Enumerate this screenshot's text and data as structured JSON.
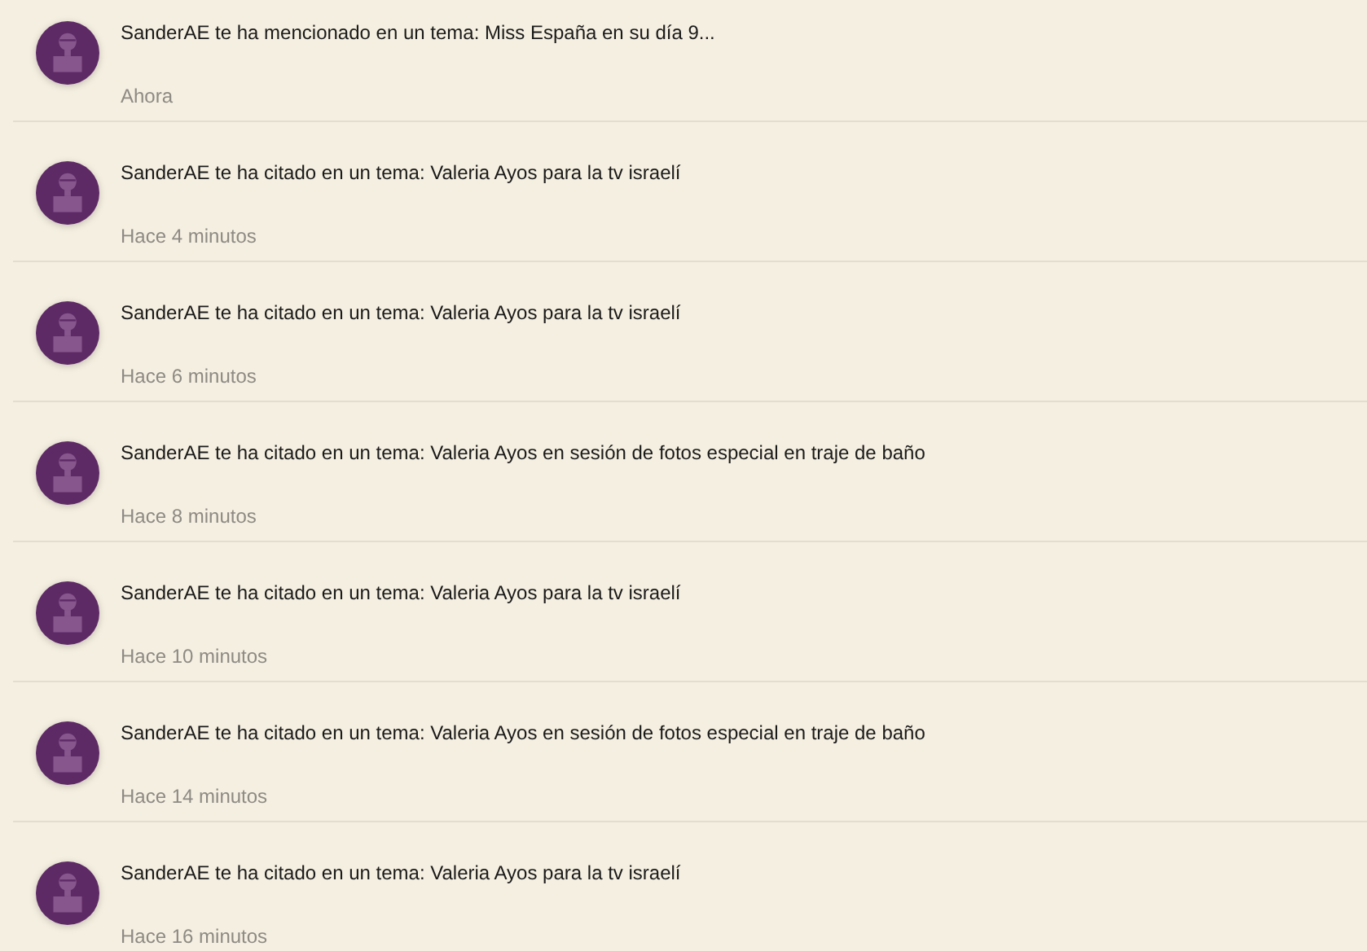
{
  "notifications": [
    {
      "message": "SanderAE te ha mencionado en un tema: Miss España en su día 9...",
      "time": "Ahora"
    },
    {
      "message": "SanderAE te ha citado en un tema: Valeria Ayos para la tv israelí",
      "time": "Hace 4 minutos"
    },
    {
      "message": "SanderAE te ha citado en un tema: Valeria Ayos para la tv israelí",
      "time": "Hace 6 minutos"
    },
    {
      "message": "SanderAE te ha citado en un tema: Valeria Ayos en sesión de fotos especial en traje de baño",
      "time": "Hace 8 minutos"
    },
    {
      "message": "SanderAE te ha citado en un tema: Valeria Ayos para la tv israelí",
      "time": "Hace 10 minutos"
    },
    {
      "message": "SanderAE te ha citado en un tema: Valeria Ayos en sesión de fotos especial en traje de baño",
      "time": "Hace 14 minutos"
    },
    {
      "message": "SanderAE te ha citado en un tema: Valeria Ayos para la tv israelí",
      "time": "Hace 16 minutos"
    }
  ]
}
